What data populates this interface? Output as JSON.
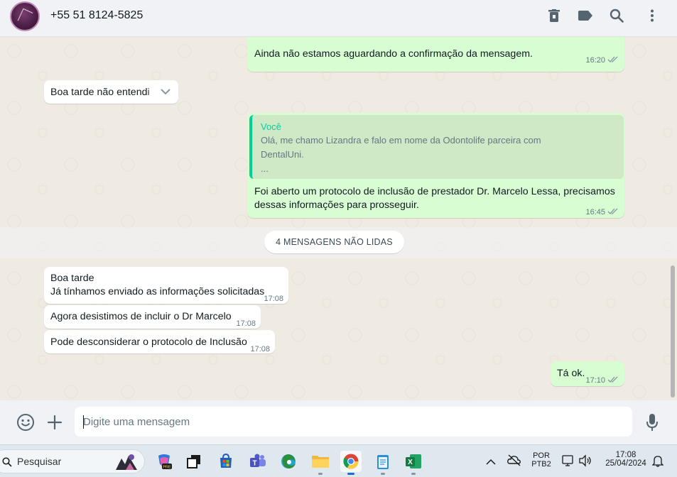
{
  "header": {
    "contact_name": "+55 51 8124-5825"
  },
  "messages": {
    "m1": {
      "text": "Ainda não estamos aguardando a confirmação da mensagem.",
      "time": "16:20"
    },
    "m2": {
      "text": "Boa tarde não entendi"
    },
    "m3": {
      "quote_author": "Você",
      "quote_line1": "Olá, me chamo Lizandra e falo em nome da Odontolife parceira com",
      "quote_line2": "DentalUni.",
      "quote_line3": "...",
      "line1": "Foi aberto um protocolo de inclusão de prestador Dr. Marcelo Lessa, precisamos",
      "line2": "dessas informações para prosseguir.",
      "time": "16:45"
    },
    "unread_label": "4 MENSAGENS NÃO LIDAS",
    "m4": {
      "line1": "Boa tarde",
      "line2": "Já tínhamos enviado as informações solicitadas",
      "time": "17:08"
    },
    "m5": {
      "text": "Agora desistimos de incluir o Dr Marcelo",
      "time": "17:08"
    },
    "m6": {
      "text": "Pode desconsiderar o protocolo de Inclusão",
      "time": "17:08"
    },
    "m7": {
      "text": "Tá ok.",
      "time": "17:10"
    }
  },
  "composer": {
    "placeholder": "Digite uma mensagem"
  },
  "taskbar": {
    "search_label": "Pesquisar",
    "lang_line1": "POR",
    "lang_line2": "PTB2",
    "clock_time": "17:08",
    "clock_date": "25/04/2024"
  },
  "colors": {
    "outgoing_bubble": "#d9fdd3",
    "incoming_bubble": "#ffffff",
    "accent": "#06cf9c",
    "read_ticks": "#8696a0"
  }
}
